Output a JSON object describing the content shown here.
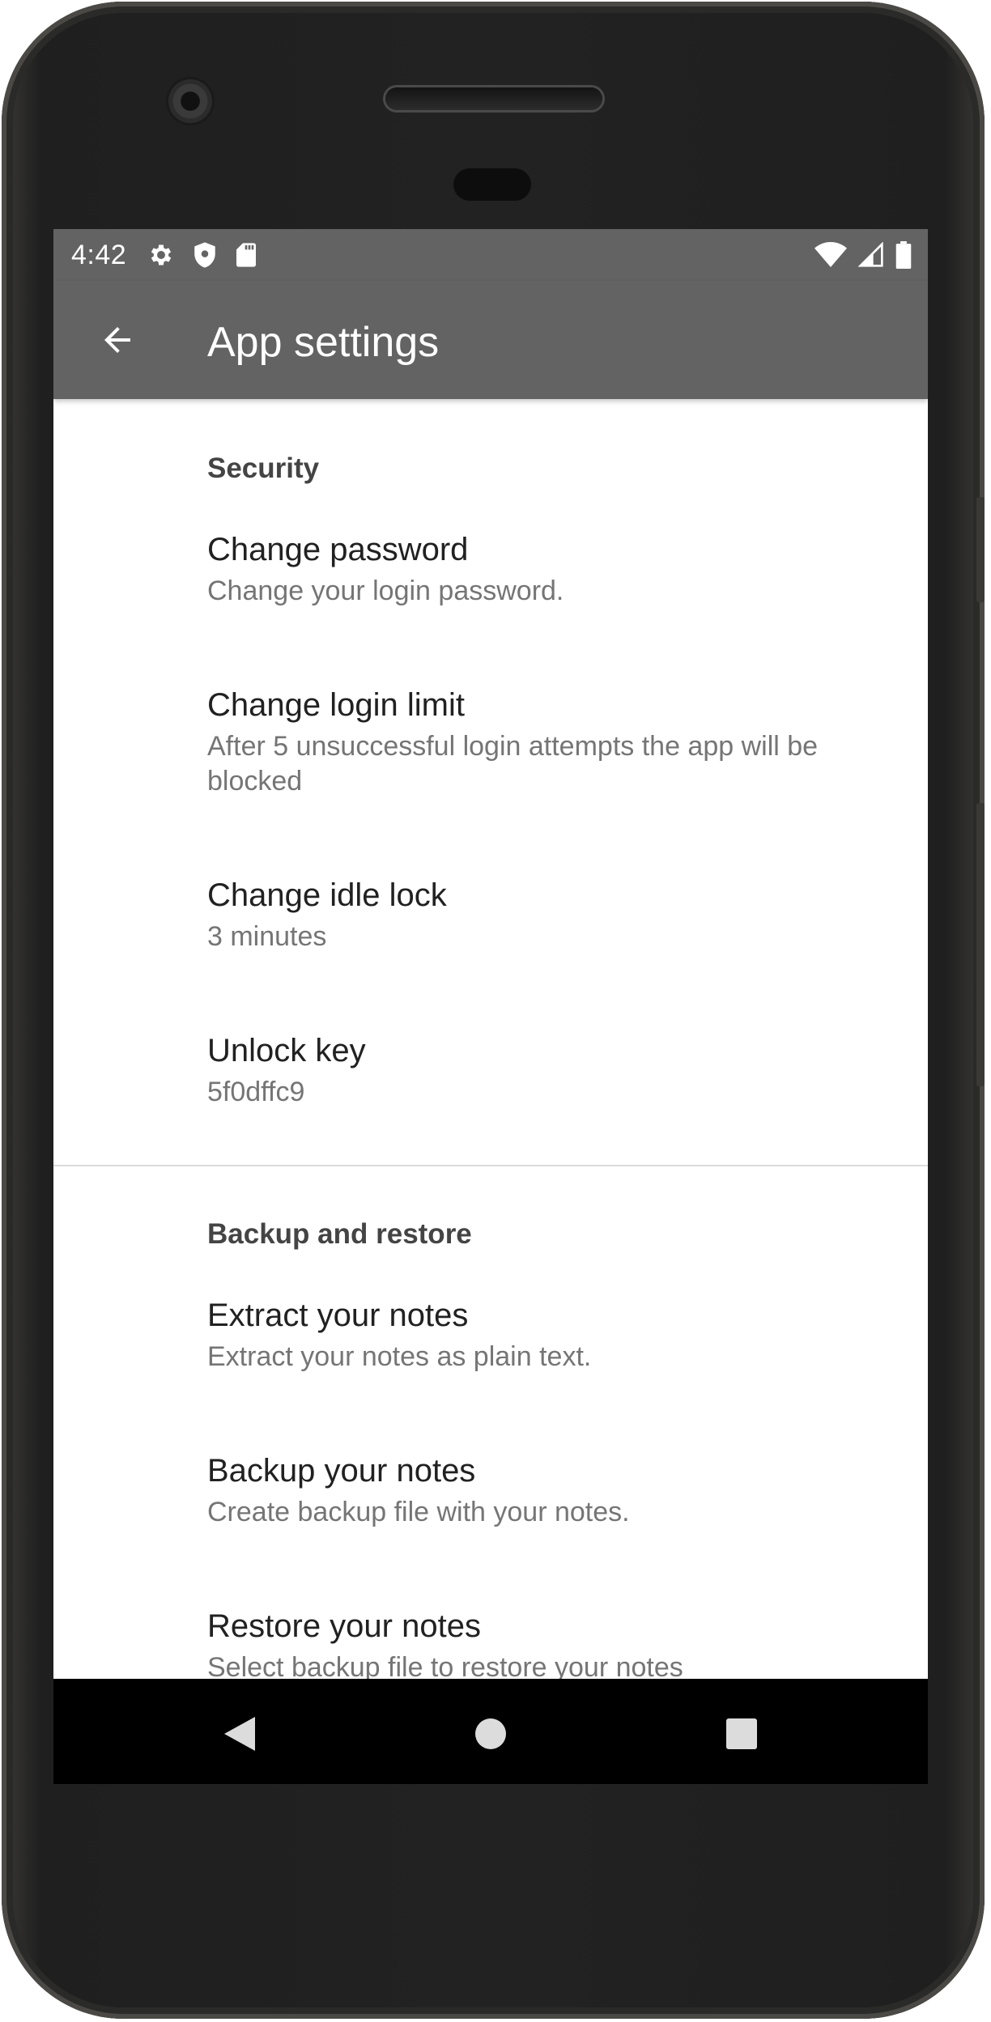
{
  "status_bar": {
    "time": "4:42",
    "left_icons": [
      "settings-icon",
      "shield-icon",
      "sd-card-icon"
    ],
    "right_icons": [
      "wifi-icon",
      "signal-icon",
      "battery-icon"
    ]
  },
  "app_bar": {
    "title": "App settings",
    "back_icon": "arrow-back-icon"
  },
  "sections": [
    {
      "title": "Security",
      "items": [
        {
          "title": "Change password",
          "summary": "Change your login password."
        },
        {
          "title": "Change login limit",
          "summary": "After 5 unsuccessful login attempts the app will be blocked"
        },
        {
          "title": "Change idle lock",
          "summary": "3 minutes"
        },
        {
          "title": "Unlock key",
          "summary": "5f0dffc9"
        }
      ]
    },
    {
      "title": "Backup and restore",
      "items": [
        {
          "title": "Extract your notes",
          "summary": "Extract your notes as plain text."
        },
        {
          "title": "Backup your notes",
          "summary": "Create backup file with your notes."
        },
        {
          "title": "Restore your notes",
          "summary": "Select backup file to restore your notes"
        }
      ]
    }
  ],
  "nav_bar": {
    "buttons": [
      "back-triangle-icon",
      "home-circle-icon",
      "recents-square-icon"
    ]
  },
  "colors": {
    "app_bar": "#636363",
    "status_bar": "#636363",
    "nav_bar": "#000000",
    "category_text": "#444444",
    "title_text": "#212121",
    "summary_text": "#757575"
  }
}
